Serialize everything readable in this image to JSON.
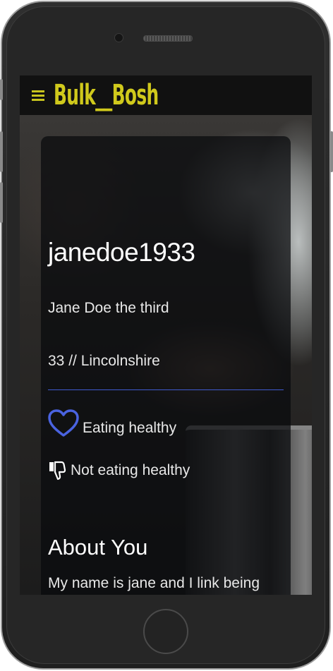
{
  "app": {
    "brand": "Bulk__Bosh",
    "menu_icon": "hamburger-icon"
  },
  "profile": {
    "username": "janedoe1933",
    "full_name": "Jane Doe the third",
    "age_location": "33 // Lincolnshire",
    "likes": [
      {
        "icon": "heart-outline-icon",
        "label": "Eating healthy"
      }
    ],
    "dislikes": [
      {
        "icon": "thumbs-down-icon",
        "label": "Not eating healthy"
      }
    ]
  },
  "about": {
    "title": "About You",
    "text": "My name is jane and I link being"
  },
  "colors": {
    "brand": "#d0c91c",
    "accent": "#3f5bd0",
    "topbar": "#111111",
    "text": "#ffffff"
  }
}
